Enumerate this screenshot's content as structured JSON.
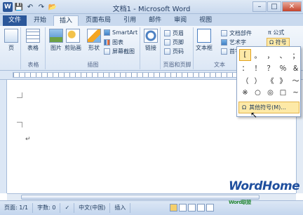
{
  "window": {
    "title": "文档1 - Microsoft Word",
    "qat_icons": [
      "word-logo-icon",
      "save-icon",
      "undo-icon",
      "redo-icon",
      "open-folder-icon"
    ],
    "word_logo": "W",
    "controls": {
      "minimize": "–",
      "maximize": "□",
      "close": "✕"
    }
  },
  "tabs": [
    "文件",
    "开始",
    "插入",
    "页面布局",
    "引用",
    "邮件",
    "审阅",
    "视图"
  ],
  "active_tab": "插入",
  "ribbon": {
    "page_label": "页",
    "group_tables": {
      "label": "表格",
      "table_button": "表格"
    },
    "group_illustrations": {
      "label": "插图",
      "picture_button": "图片",
      "clipart_button": "剪贴画",
      "shapes_button": "形状",
      "smartart": "SmartArt",
      "chart": "图表",
      "screenshot": "屏幕截图"
    },
    "group_links": {
      "link_button": "链接"
    },
    "group_header_footer": {
      "label": "页眉和页脚",
      "header": "页眉",
      "footer": "页脚",
      "page_number": "页码"
    },
    "group_text": {
      "label": "文本",
      "textbox_button": "文本框",
      "docparts": "文档部件",
      "wordart": "艺术字",
      "dropcap": "首字下沉"
    },
    "group_symbols": {
      "formula": "π 公式",
      "symbol": "Ω 符号"
    }
  },
  "symbol_menu": {
    "symbols": [
      "[",
      "。",
      "，",
      "、",
      "；",
      "：",
      "！",
      "？",
      "％",
      "＆",
      "（",
      "）",
      "《",
      "》",
      "～",
      "※",
      "○",
      "◎",
      "□",
      "~"
    ],
    "more_symbols": "其他符号(M)..."
  },
  "document": {
    "paragraph_mark": "↵"
  },
  "status": {
    "page": "页面: 1/1",
    "words": "字数: 0",
    "language": "中文(中国)",
    "mode": "插入"
  },
  "brand": {
    "name": "WordHome",
    "sub": "Word联盟"
  }
}
